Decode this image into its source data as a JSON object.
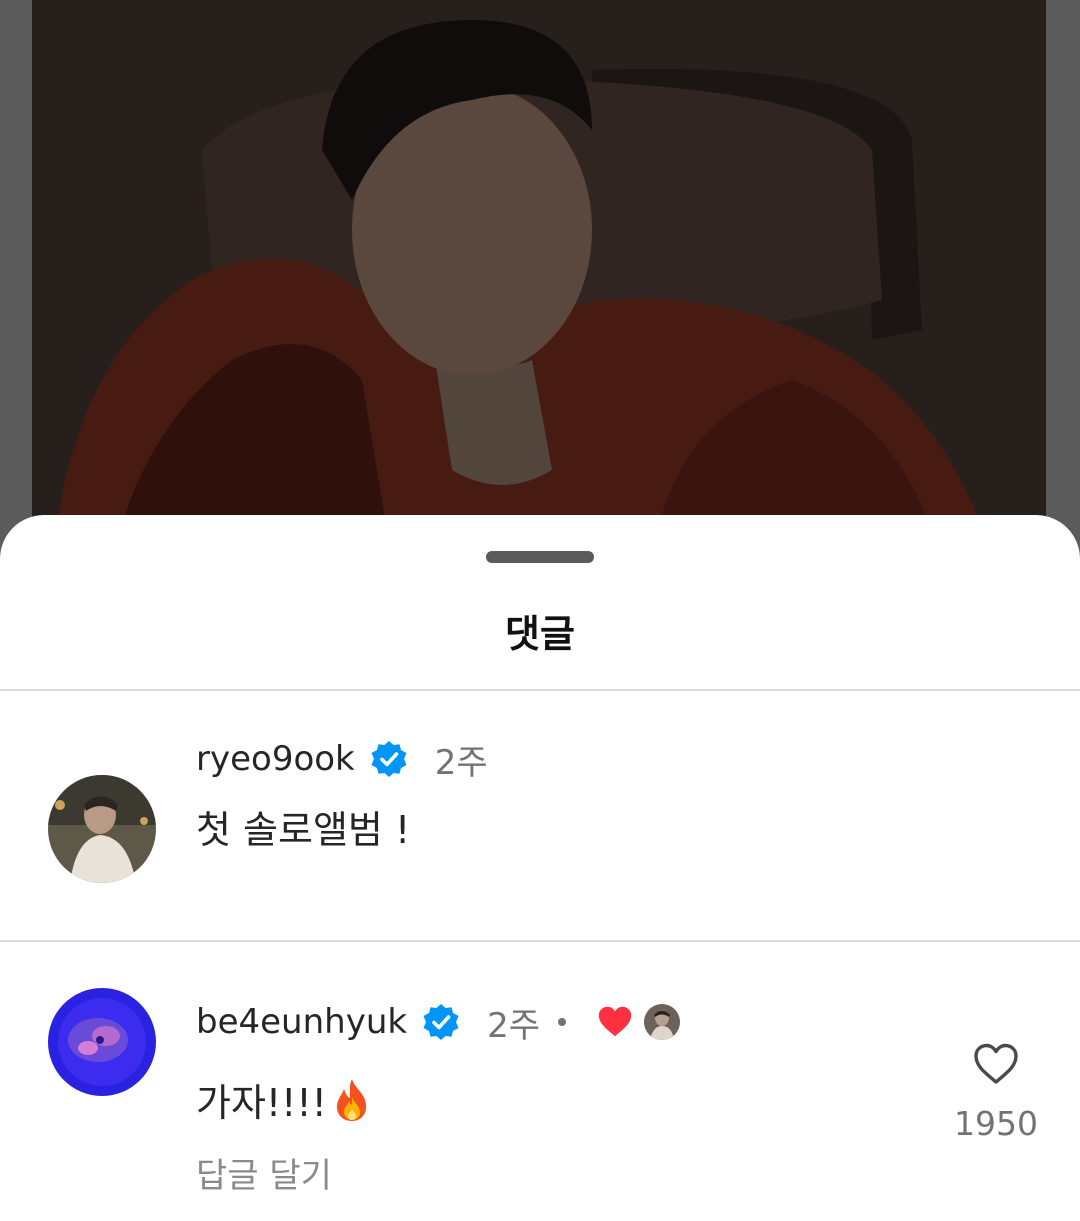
{
  "sheet": {
    "title": "댓글"
  },
  "comments": [
    {
      "username": "ryeo9ook",
      "verified": true,
      "time": "2주",
      "text": "첫 솔로앨범 !"
    },
    {
      "username": "be4eunhyuk",
      "verified": true,
      "time": "2주",
      "author_liked": true,
      "text": "가자!!!!",
      "emoji": "fire-icon",
      "reply_label": "답글 달기",
      "like_count": "1950"
    }
  ],
  "colors": {
    "verified_blue": "#0095f6",
    "heart_red": "#ff3040",
    "sheet_bg": "#ffffff"
  }
}
